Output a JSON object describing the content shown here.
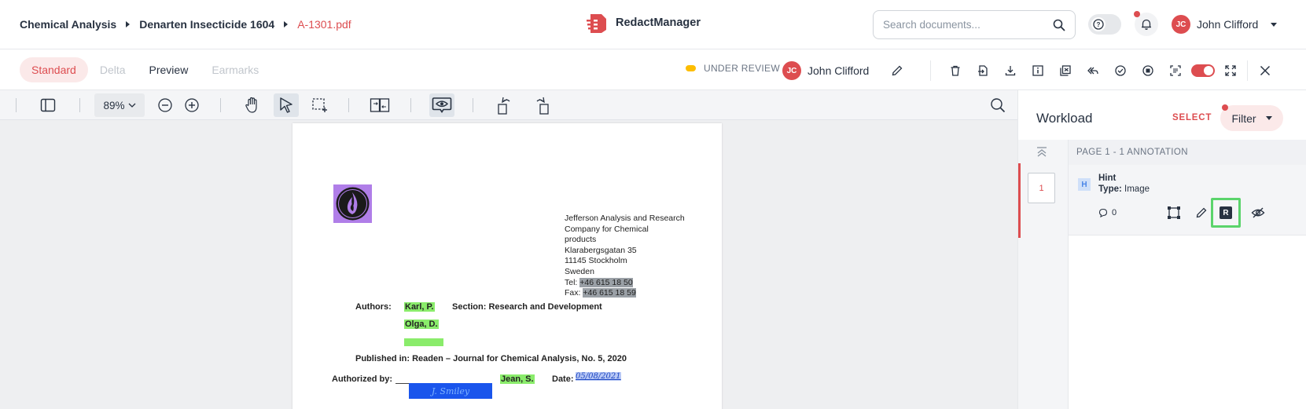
{
  "breadcrumb": {
    "items": [
      "Chemical Analysis",
      "Denarten Insecticide 1604"
    ],
    "current": "A-1301.pdf"
  },
  "app": {
    "name": "RedactManager",
    "brand_color": "#dd4d50"
  },
  "search": {
    "placeholder": "Search documents..."
  },
  "user": {
    "initials": "JC",
    "name": "John Clifford"
  },
  "tabs": [
    {
      "label": "Standard",
      "state": "active"
    },
    {
      "label": "Delta",
      "state": "disabled"
    },
    {
      "label": "Preview",
      "state": "normal"
    },
    {
      "label": "Earmarks",
      "state": "disabled"
    }
  ],
  "status": {
    "label": "UNDER REVIEW",
    "color": "#fdbd00"
  },
  "assignee": {
    "initials": "JC",
    "name": "John Clifford"
  },
  "toolbar": {
    "zoom": "89%"
  },
  "document": {
    "address": [
      "Jefferson Analysis and Research",
      "Company for Chemical",
      "products",
      "Klarabergsgatan 35",
      "11145 Stockholm",
      "Sweden"
    ],
    "tel_label": "Tel:",
    "tel": "+46 615 18 50",
    "fax_label": "Fax:",
    "fax": "+46 615 18 59",
    "authors_label": "Authors:",
    "author1": "Karl, P.",
    "author2": "Olga, D.",
    "section": "Section: Research and Development",
    "published": "Published in: Readen – Journal for Chemical Analysis, No. 5, 2020",
    "authorized_label": "Authorized by:",
    "signature": "J. Smiley",
    "signer": "Jean, S.",
    "date_label": "Date:",
    "date": "05/08/2021"
  },
  "panel": {
    "title": "Workload",
    "select_label": "SELECT",
    "filter_label": "Filter",
    "page_number": "1",
    "section_header": "PAGE 1 - 1 ANNOTATION",
    "annotation": {
      "badge": "H",
      "title": "Hint",
      "type_label": "Type:",
      "type_value": "Image",
      "comment_count": "0",
      "recategorize_badge": "R"
    }
  }
}
